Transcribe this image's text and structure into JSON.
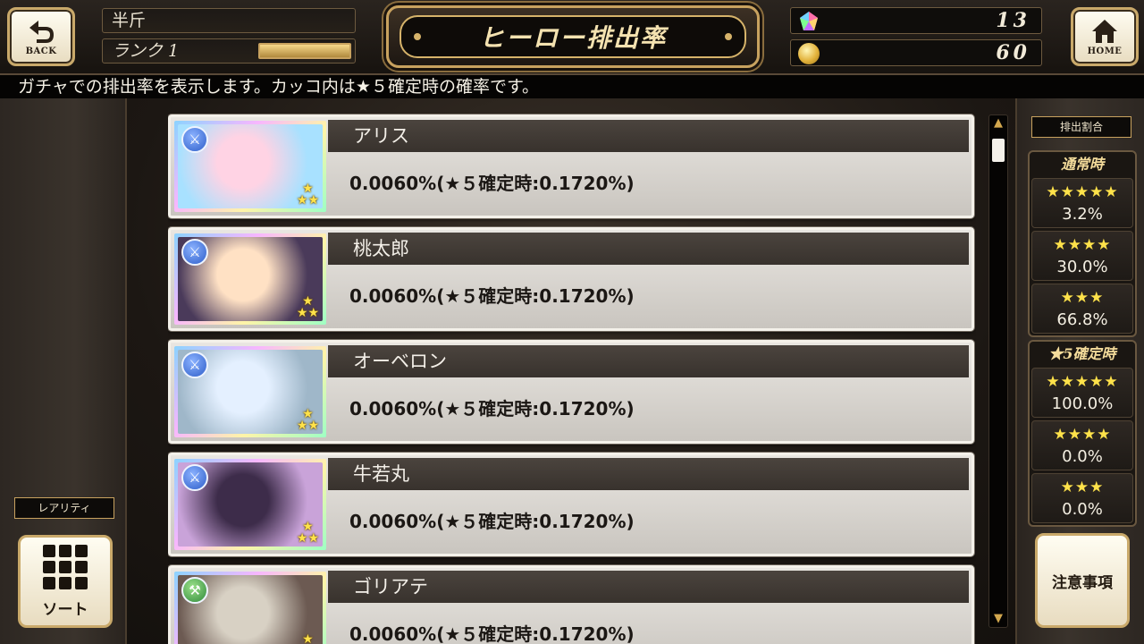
{
  "header": {
    "back_label": "BACK",
    "home_label": "HOME",
    "player_name": "半斤",
    "rank_label": "ランク 1",
    "rank_progress": 1.0,
    "title": "ヒーロー排出率",
    "gems": "13",
    "coins": "60"
  },
  "info": "ガチャでの排出率を表示します。カッコ内は★５確定時の確率です。",
  "heroes": [
    {
      "name": "アリス",
      "rate": "0.0060%(★５確定時:0.1720%)",
      "type_icon": "sword-icon",
      "stars": 3
    },
    {
      "name": "桃太郎",
      "rate": "0.0060%(★５確定時:0.1720%)",
      "type_icon": "sword-icon",
      "stars": 3
    },
    {
      "name": "オーベロン",
      "rate": "0.0060%(★５確定時:0.1720%)",
      "type_icon": "sword-icon",
      "stars": 3
    },
    {
      "name": "牛若丸",
      "rate": "0.0060%(★５確定時:0.1720%)",
      "type_icon": "sword-icon",
      "stars": 3
    },
    {
      "name": "ゴリアテ",
      "rate": "0.0060%(★５確定時:0.1720%)",
      "type_icon": "axe-icon",
      "stars": 3
    }
  ],
  "right_panel": {
    "ratio_label": "排出割合",
    "normal": {
      "title": "通常時",
      "rows": [
        {
          "stars": "★★★★★",
          "pct": "3.2%"
        },
        {
          "stars": "★★★★",
          "pct": "30.0%"
        },
        {
          "stars": "★★★",
          "pct": "66.8%"
        }
      ]
    },
    "guaranteed": {
      "title": "★5確定時",
      "rows": [
        {
          "stars": "★★★★★",
          "pct": "100.0%"
        },
        {
          "stars": "★★★★",
          "pct": "0.0%"
        },
        {
          "stars": "★★★",
          "pct": "0.0%"
        }
      ]
    },
    "notice_label": "注意事項"
  },
  "left_panel": {
    "rarity_label": "レアリティ",
    "sort_label": "ソート"
  },
  "colors": {
    "accent_gold": "#c8a25f",
    "star_yellow": "#ffe24a",
    "sword_blue": "#2e5ec9",
    "axe_green": "#2f8a3a"
  }
}
